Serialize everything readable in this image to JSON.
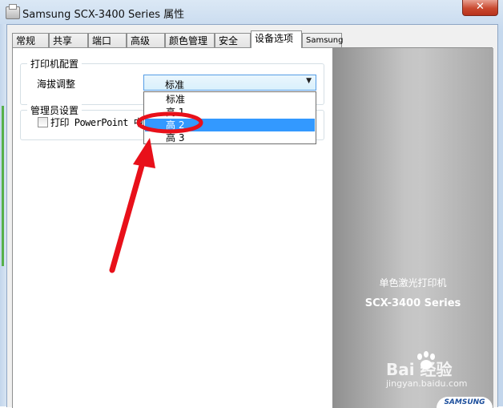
{
  "window": {
    "title": "Samsung SCX-3400 Series 属性",
    "close_label": "✕"
  },
  "tabs": [
    {
      "label": "常规"
    },
    {
      "label": "共享"
    },
    {
      "label": "端口"
    },
    {
      "label": "高级"
    },
    {
      "label": "颜色管理"
    },
    {
      "label": "安全"
    },
    {
      "label": "设备选项"
    },
    {
      "label": "Samsung"
    }
  ],
  "active_tab": "设备选项",
  "printer_config": {
    "group_title": "打印机配置",
    "altitude_label": "海拔调整",
    "combo": {
      "value": "标准",
      "options": [
        "标准",
        "高 1",
        "高 2",
        "高 3"
      ],
      "highlighted": "高 2"
    }
  },
  "admin": {
    "group_title": "管理员设置",
    "checkbox_label": "打印 PowerPoint 中",
    "checked": false
  },
  "side_panel": {
    "subtitle": "单色激光打印机",
    "model": "SCX-3400 Series",
    "logo": "SAMSUNG"
  },
  "watermark": {
    "main": "Bai 经验",
    "sub": "jingyan.baidu.com"
  },
  "annotation": {
    "color": "#e8101a"
  }
}
